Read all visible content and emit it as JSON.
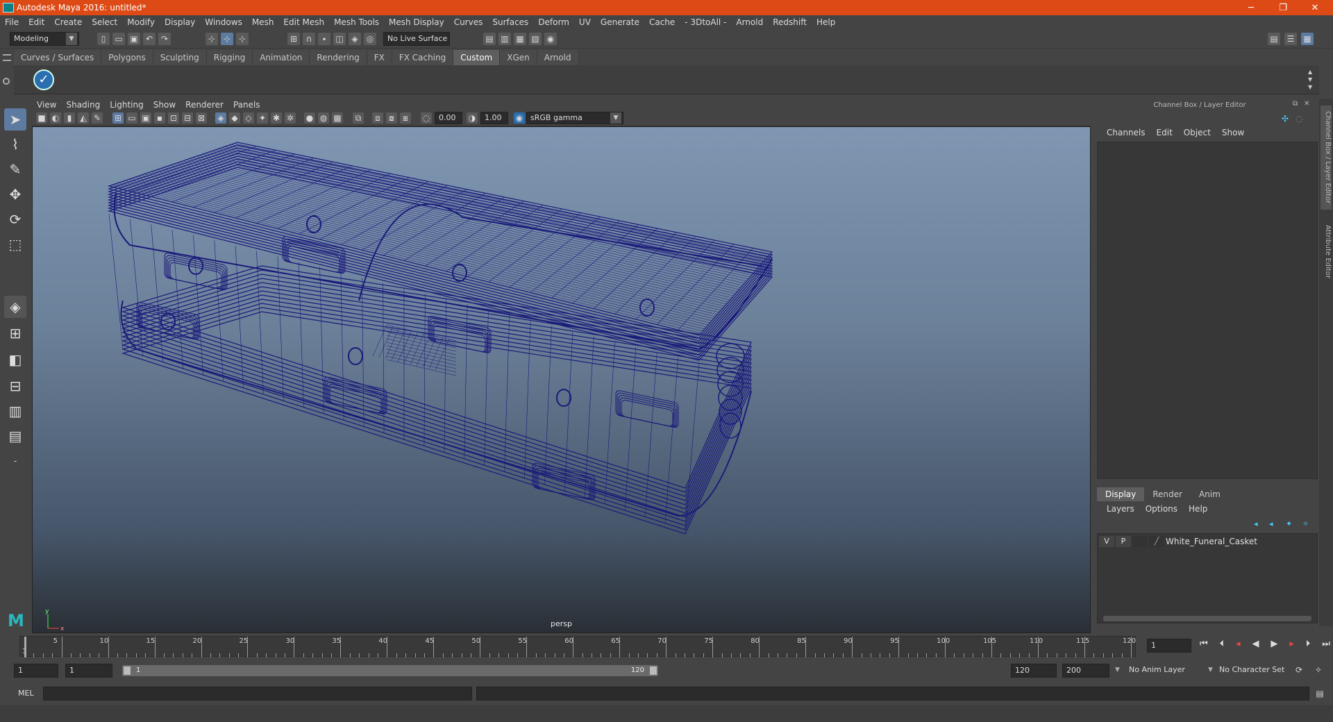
{
  "window": {
    "title": "Autodesk Maya 2016: untitled*",
    "minimize": "─",
    "restore": "❐",
    "close": "✕"
  },
  "menubar": [
    "File",
    "Edit",
    "Create",
    "Select",
    "Modify",
    "Display",
    "Windows",
    "Mesh",
    "Edit Mesh",
    "Mesh Tools",
    "Mesh Display",
    "Curves",
    "Surfaces",
    "Deform",
    "UV",
    "Generate",
    "Cache",
    "- 3DtoAll -",
    "Arnold",
    "Redshift",
    "Help"
  ],
  "statusline": {
    "mode": "Modeling",
    "live_surface": "No Live Surface"
  },
  "shelf": {
    "tabs": [
      "Curves / Surfaces",
      "Polygons",
      "Sculpting",
      "Rigging",
      "Animation",
      "Rendering",
      "FX",
      "FX Caching",
      "Custom",
      "XGen",
      "Arnold"
    ],
    "active_tab": "Custom"
  },
  "viewport": {
    "menu": [
      "View",
      "Shading",
      "Lighting",
      "Show",
      "Renderer",
      "Panels"
    ],
    "exposure": "0.00",
    "gamma": "1.00",
    "color_space": "sRGB gamma",
    "camera_label": "persp",
    "axis_y": "y",
    "axis_x": "x",
    "wire_color": "#1a1a7a"
  },
  "channel_box": {
    "title": "Channel Box / Layer Editor",
    "menu": [
      "Channels",
      "Edit",
      "Object",
      "Show"
    ]
  },
  "side_tabs": [
    "Channel Box / Layer Editor",
    "Attribute Editor"
  ],
  "layer_editor": {
    "tabs": [
      "Display",
      "Render",
      "Anim"
    ],
    "active_tab": "Display",
    "menu": [
      "Layers",
      "Options",
      "Help"
    ],
    "layers": [
      {
        "visible": "V",
        "playback": "P",
        "name": "White_Funeral_Casket"
      }
    ]
  },
  "timeline": {
    "ticks": [
      "5",
      "10",
      "15",
      "20",
      "25",
      "30",
      "35",
      "40",
      "45",
      "50",
      "55",
      "60",
      "65",
      "70",
      "75",
      "80",
      "85",
      "90",
      "95",
      "100",
      "105",
      "110",
      "115",
      "120"
    ],
    "start_tick_label": "1",
    "current_frame": "1"
  },
  "range": {
    "start_time": "1",
    "playback_start": "1",
    "slider_start": "1",
    "slider_end": "120",
    "playback_end": "120",
    "end_time": "200",
    "anim_layer": "No Anim Layer",
    "character_set": "No Character Set"
  },
  "command": {
    "language": "MEL"
  }
}
